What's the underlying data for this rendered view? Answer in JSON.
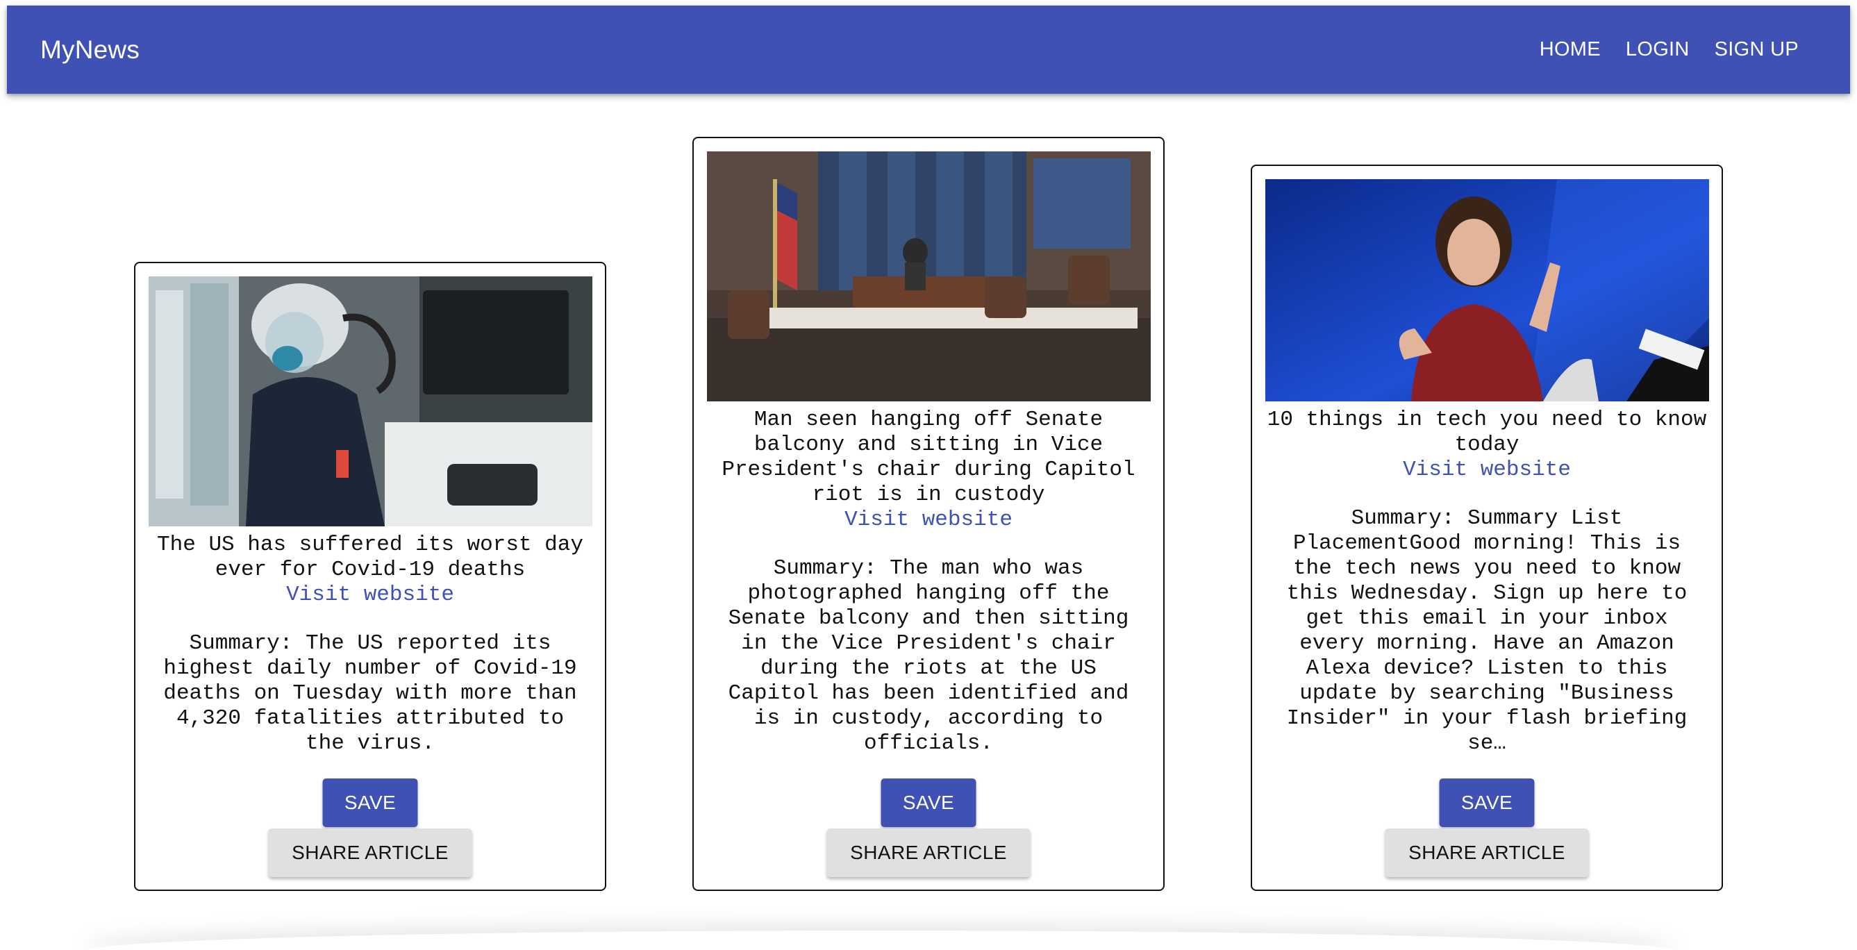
{
  "app": {
    "brand": "MyNews",
    "nav": {
      "home": "HOME",
      "login": "LOGIN",
      "signup": "SIGN UP"
    },
    "colors": {
      "primary": "#3f51b5",
      "secondary_button": "#e0e0e0"
    }
  },
  "articles": [
    {
      "title": "The US has suffered its worst day ever for Covid-19 deaths",
      "link_text": "Visit website",
      "summary": "Summary: The US reported its highest daily number of Covid-19 deaths on Tuesday with more than 4,320 fatalities attributed to the virus.",
      "image_subject": "healthcare worker in protective gear in hospital room",
      "save_label": "SAVE",
      "share_label": "SHARE ARTICLE"
    },
    {
      "title": "Man seen hanging off Senate balcony and sitting in Vice President's chair during Capitol riot is in custody",
      "link_text": "Visit website",
      "summary": "Summary: The man who was photographed hanging off the Senate balcony and then sitting in the Vice President's chair during the riots at the US Capitol has been identified and is in custody, according to officials.",
      "image_subject": "Senate chamber dais with flags",
      "save_label": "SAVE",
      "share_label": "SHARE ARTICLE"
    },
    {
      "title": "10 things in tech you need to know today",
      "link_text": "Visit website",
      "summary": "Summary: Summary List PlacementGood morning! This is the tech news you need to know this Wednesday. Sign up here to get this email in your inbox every morning. Have an Amazon Alexa device? Listen to this update by searching \"Business Insider\" in your flash briefing se…",
      "image_subject": "woman speaking on stage with blue background",
      "save_label": "SAVE",
      "share_label": "SHARE ARTICLE"
    }
  ]
}
